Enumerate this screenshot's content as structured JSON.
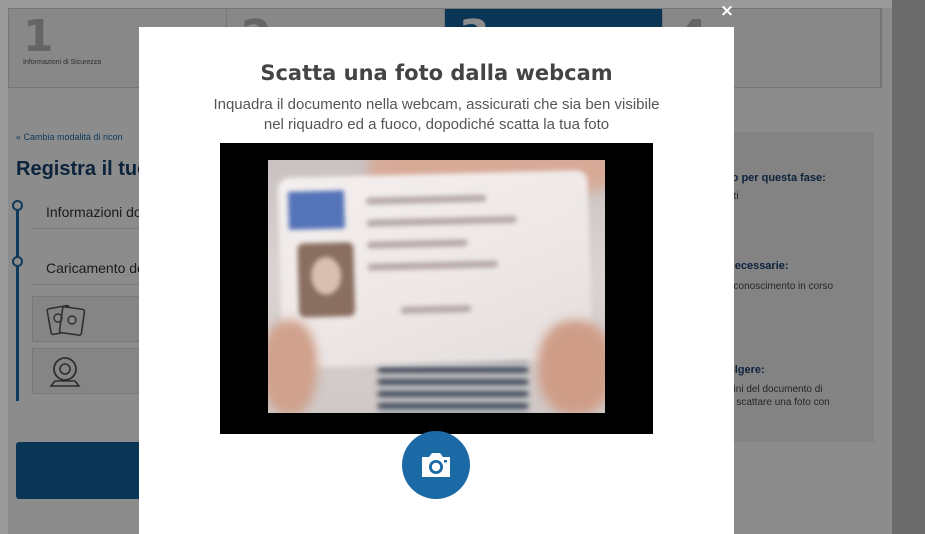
{
  "steps": [
    {
      "number": "1",
      "label": "Informazioni di Sicurezza"
    },
    {
      "number": "2",
      "label": ""
    },
    {
      "number": "3",
      "label": ""
    },
    {
      "number": "4",
      "label": ""
    }
  ],
  "background": {
    "change_link": "« Cambia modalità di ricon",
    "register_title": "Registra il tuo",
    "timeline": [
      "Informazioni do",
      "Caricamento do"
    ],
    "side_panel": {
      "h1": "to per questa fase:",
      "t1": "uti",
      "h2": "necessarie:",
      "t2": "riconoscimento in corso",
      "h3": "olgere:",
      "t3": "gini del documento di\ne scattare una foto con"
    }
  },
  "modal": {
    "title": "Scatta una foto dalla webcam",
    "subtitle": "Inquadra il documento nella webcam, assicurati che sia ben visibile nel riquadro ed a fuoco, dopodiché scatta la tua foto",
    "close_label": "×",
    "capture_icon": "camera-icon"
  },
  "colors": {
    "primary": "#1b6aa5",
    "title_dark": "#16406e"
  }
}
